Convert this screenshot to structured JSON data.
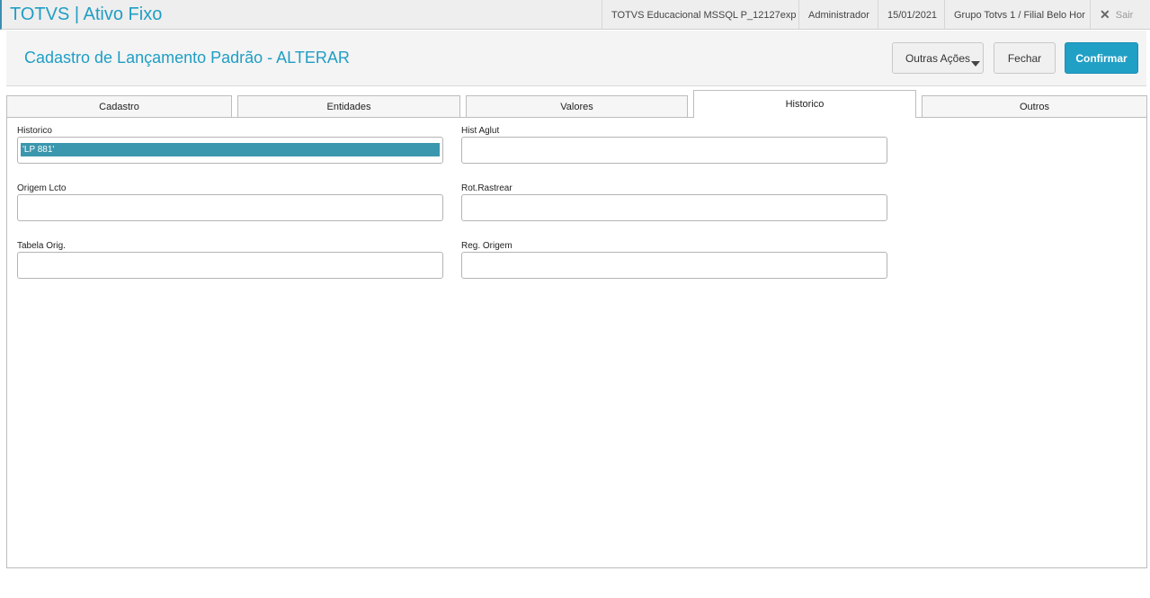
{
  "app": {
    "title": "TOTVS | Ativo Fixo"
  },
  "topbar": {
    "environment": "TOTVS Educacional MSSQL P_12127exp",
    "user": "Administrador",
    "date": "15/01/2021",
    "branch": "Grupo Totvs 1 / Filial Belo Hor",
    "exit_label": "Sair",
    "exit_icon": "close-icon"
  },
  "header": {
    "title": "Cadastro de Lançamento Padrão - ALTERAR",
    "buttons": {
      "more_actions": "Outras Ações",
      "close": "Fechar",
      "confirm": "Confirmar"
    }
  },
  "tabs": [
    {
      "label": "Cadastro",
      "active": false
    },
    {
      "label": "Entidades",
      "active": false
    },
    {
      "label": "Valores",
      "active": false
    },
    {
      "label": "Historico",
      "active": true
    },
    {
      "label": "Outros",
      "active": false
    }
  ],
  "form": {
    "historico": {
      "label": "Historico",
      "value": "'LP 881'"
    },
    "hist_aglut": {
      "label": "Hist Aglut",
      "value": ""
    },
    "origem_lcto": {
      "label": "Origem Lcto",
      "value": ""
    },
    "rot_rastrear": {
      "label": "Rot.Rastrear",
      "value": ""
    },
    "tabela_orig": {
      "label": "Tabela Orig.",
      "value": ""
    },
    "reg_origem": {
      "label": "Reg. Origem",
      "value": ""
    }
  },
  "colors": {
    "accent": "#1f9ec4",
    "confirm_bg": "#21a0c6",
    "selection": "#3b97ad"
  }
}
